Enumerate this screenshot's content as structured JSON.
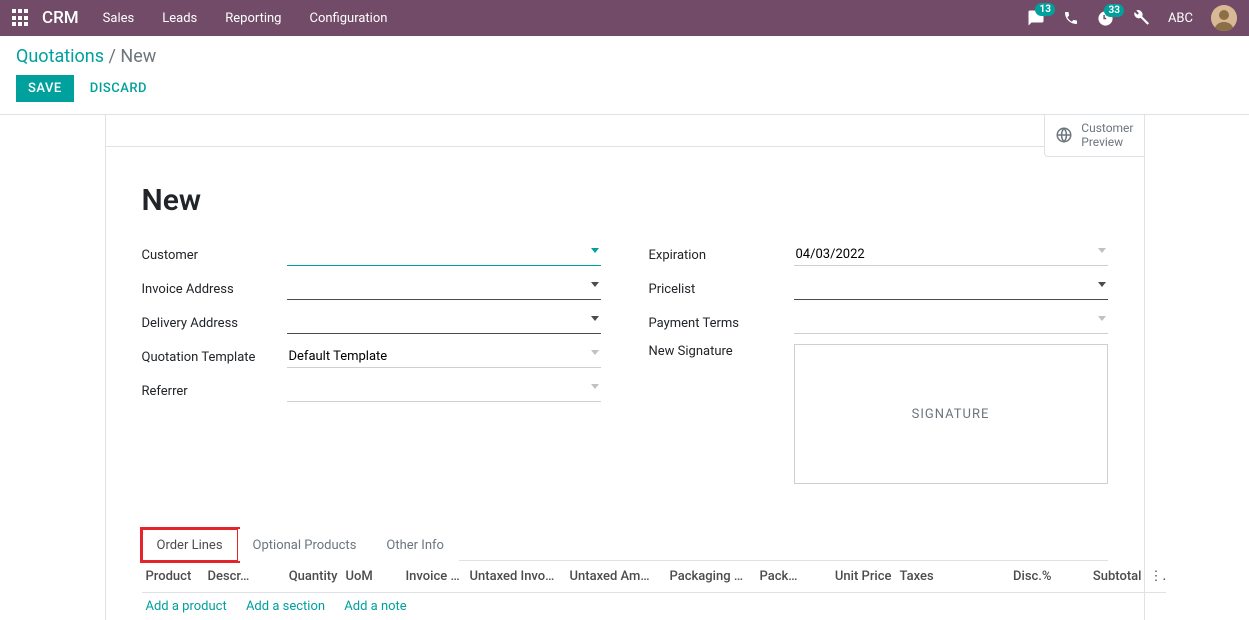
{
  "topbar": {
    "brand": "CRM",
    "menu": [
      "Sales",
      "Leads",
      "Reporting",
      "Configuration"
    ],
    "messages_badge": "13",
    "activities_badge": "33",
    "user": "ABC"
  },
  "breadcrumb": {
    "parent": "Quotations",
    "separator": "/",
    "current": "New"
  },
  "actions": {
    "save": "SAVE",
    "discard": "DISCARD"
  },
  "stat_button": {
    "line1": "Customer",
    "line2": "Preview"
  },
  "title": "New",
  "form": {
    "customer_label": "Customer",
    "customer_value": "",
    "invoice_address_label": "Invoice Address",
    "invoice_address_value": "",
    "delivery_address_label": "Delivery Address",
    "delivery_address_value": "",
    "quotation_template_label": "Quotation Template",
    "quotation_template_value": "Default Template",
    "referrer_label": "Referrer",
    "referrer_value": "",
    "expiration_label": "Expiration",
    "expiration_value": "04/03/2022",
    "pricelist_label": "Pricelist",
    "pricelist_value": "",
    "payment_terms_label": "Payment Terms",
    "payment_terms_value": "",
    "new_signature_label": "New Signature",
    "signature_placeholder": "SIGNATURE"
  },
  "tabs": {
    "order_lines": "Order Lines",
    "optional_products": "Optional Products",
    "other_info": "Other Info"
  },
  "table": {
    "headers": {
      "product": "Product",
      "description": "Descr…",
      "quantity": "Quantity",
      "uom": "UoM",
      "invoice": "Invoice …",
      "untaxed_inv": "Untaxed Invo…",
      "untaxed_am": "Untaxed Am…",
      "packaging1": "Packaging …",
      "packaging2": "Pack…",
      "unit_price": "Unit Price",
      "taxes": "Taxes",
      "disc": "Disc.%",
      "subtotal": "Subtotal"
    },
    "add_product": "Add a product",
    "add_section": "Add a section",
    "add_note": "Add a note"
  }
}
